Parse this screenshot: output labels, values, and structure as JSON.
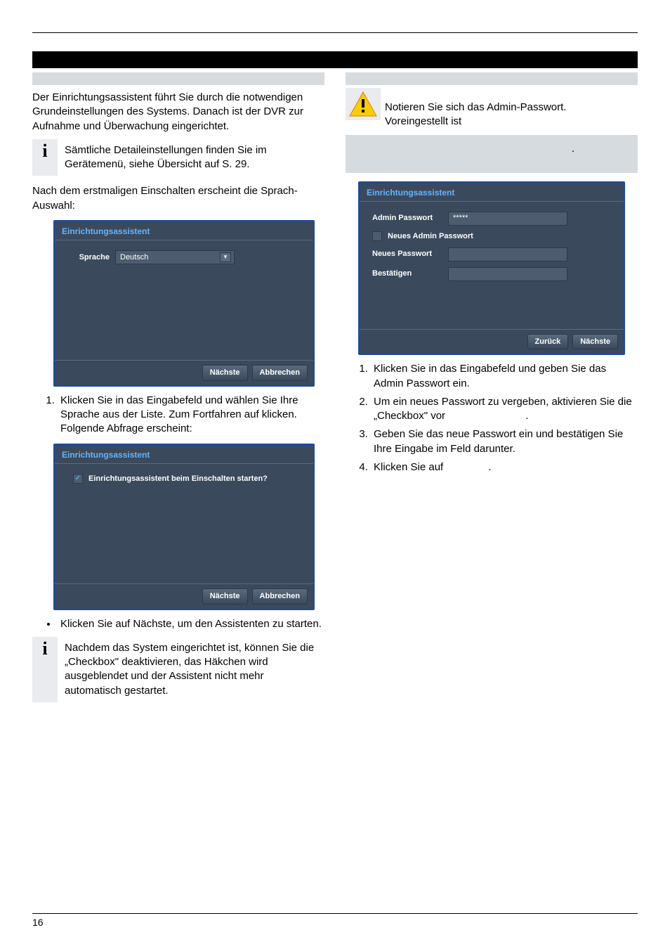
{
  "header": {
    "pageNumber": "16"
  },
  "left": {
    "intro": "Der Einrichtungsassistent führt Sie durch die notwendigen Grundeinstellungen des Systems. Danach ist der DVR zur Aufnahme und Überwachung eingerichtet.",
    "info1": "Sämtliche Detaileinstellungen finden Sie im Gerätemenü, siehe Übersicht auf S. 29.",
    "afterInfo": "Nach dem erstmaligen Einschalten erscheint die Sprach-Auswahl:",
    "ss1": {
      "title": "Einrichtungsassistent",
      "label": "Sprache",
      "value": "Deutsch",
      "btnNext": "Nächste",
      "btnCancel": "Abbrechen"
    },
    "step1": "Klicken Sie in das Eingabefeld und wählen Sie Ihre Sprache aus der Liste. Zum Fortfahren auf klicken. Folgende Abfrage erscheint:",
    "ss2": {
      "title": "Einrichtungsassistent",
      "checklabel": "Einrichtungsassistent beim Einschalten starten?",
      "btnNext": "Nächste",
      "btnCancel": "Abbrechen"
    },
    "bullet1": "Klicken Sie auf Nächste, um den Assistenten zu starten.",
    "info2": "Nachdem das System eingerichtet ist, können Sie die „Checkbox\" deaktivieren, das Häkchen wird ausgeblendet und der Assistent nicht mehr automatisch gestartet."
  },
  "right": {
    "warn1": "Notieren Sie sich das Admin-Passwort.",
    "warn2": "Voreingestellt ist",
    "dot": ".",
    "ss3": {
      "title": "Einrichtungsassistent",
      "row1": "Admin Passwort",
      "row1val": "*****",
      "row2": "Neues Admin Passwort",
      "row3": "Neues Passwort",
      "row4": "Bestätigen",
      "btnBack": "Zurück",
      "btnNext": "Nächste"
    },
    "steps": {
      "s1": "Klicken Sie in das Eingabefeld und geben Sie das Admin Passwort ein.",
      "s2a": "Um ein neues Passwort zu vergeben, aktivieren Sie die „Checkbox\" vor",
      "s2b": ".",
      "s3": "Geben Sie das neue Passwort ein und bestätigen Sie Ihre Eingabe im Feld darunter.",
      "s4a": "Klicken Sie auf",
      "s4b": "."
    }
  }
}
